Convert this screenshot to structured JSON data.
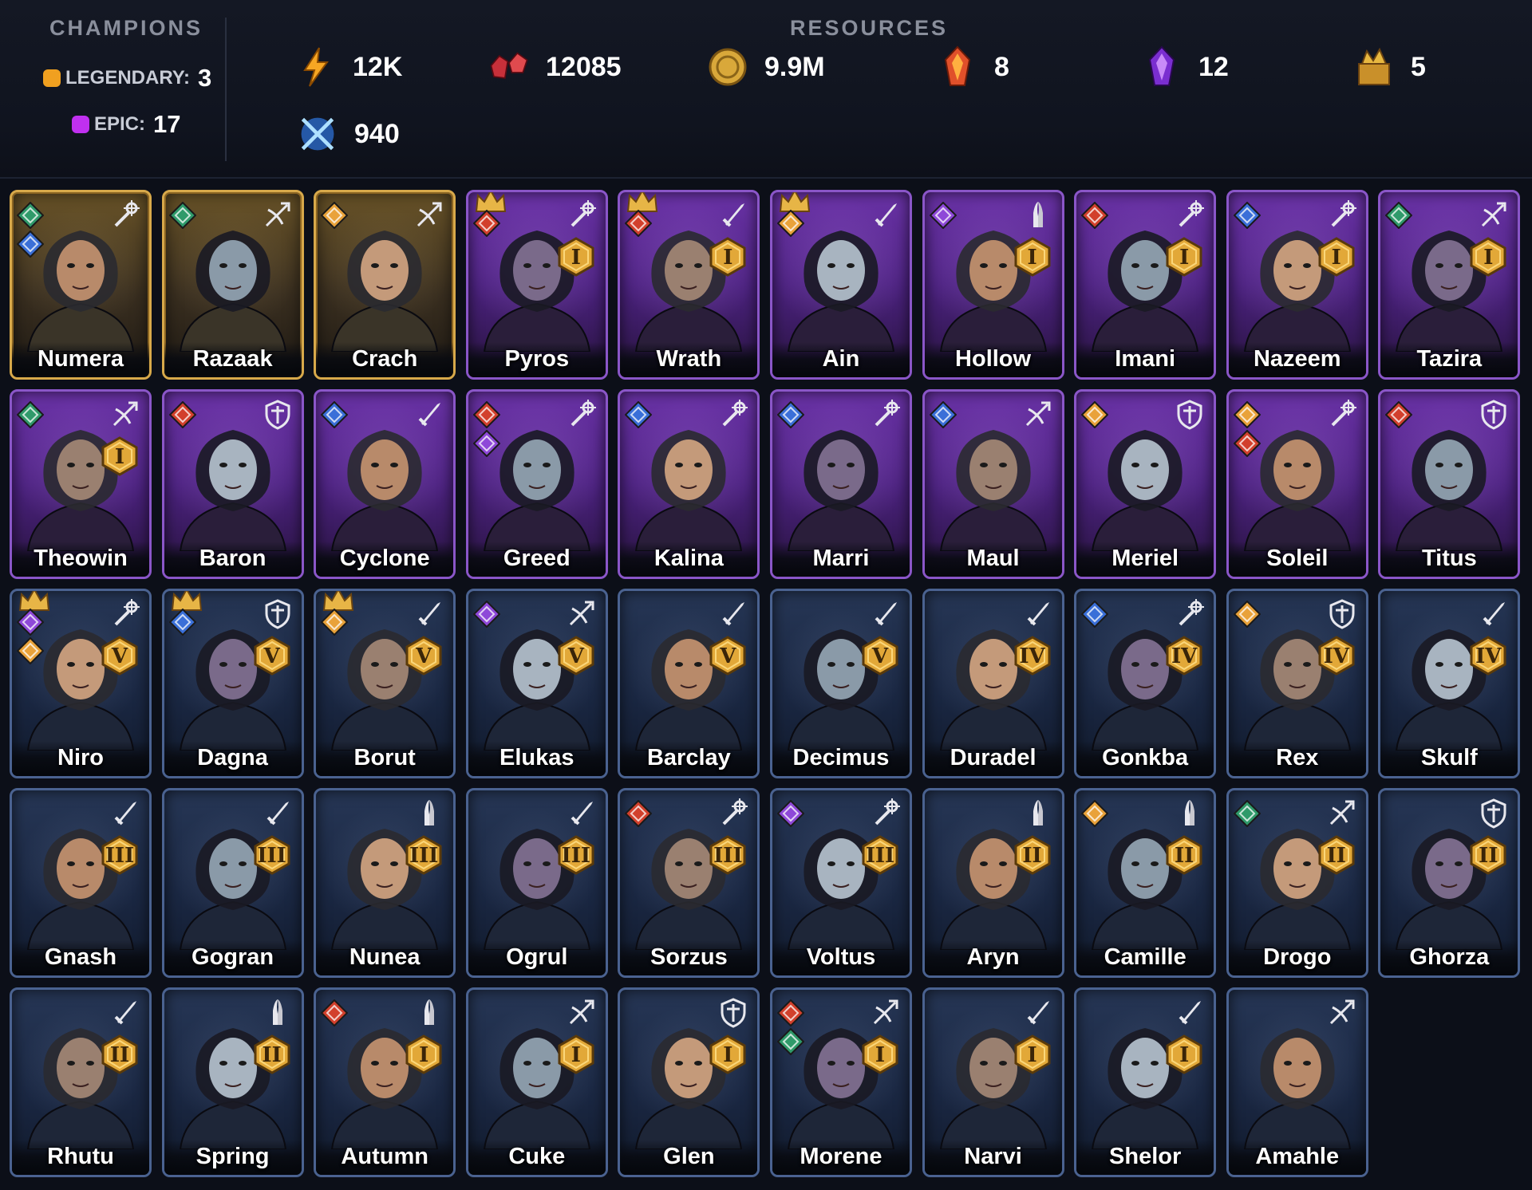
{
  "champions_panel": {
    "title": "CHAMPIONS",
    "legendary_label": "LEGENDARY:",
    "legendary_count": "3",
    "epic_label": "EPIC:",
    "epic_count": "17",
    "legendary_color": "#f0a020",
    "epic_color": "#c030f0"
  },
  "resources_panel": {
    "title": "RESOURCES",
    "items": [
      {
        "name": "energy-icon",
        "value": "12K"
      },
      {
        "name": "rubies-icon",
        "value": "12085"
      },
      {
        "name": "gold-icon",
        "value": "9.9M"
      },
      {
        "name": "legendary-shard-icon",
        "value": "8"
      },
      {
        "name": "epic-shard-icon",
        "value": "12"
      },
      {
        "name": "treasure-icon",
        "value": "5"
      },
      {
        "name": "arena-token-icon",
        "value": "940"
      }
    ]
  },
  "champions": [
    {
      "name": "Numera",
      "rarity": "legendary",
      "class": "magic",
      "affinities": [
        "green",
        "blue"
      ],
      "stars": "",
      "crown": ""
    },
    {
      "name": "Razaak",
      "rarity": "legendary",
      "class": "ranged",
      "affinities": [
        "green"
      ],
      "stars": "",
      "crown": ""
    },
    {
      "name": "Crach",
      "rarity": "legendary",
      "class": "ranged",
      "affinities": [
        "gold"
      ],
      "stars": "",
      "crown": ""
    },
    {
      "name": "Pyros",
      "rarity": "epic",
      "class": "magic",
      "affinities": [
        "red"
      ],
      "stars": "I",
      "crown": "gold"
    },
    {
      "name": "Wrath",
      "rarity": "epic",
      "class": "melee",
      "affinities": [
        "red"
      ],
      "stars": "I",
      "crown": "gold"
    },
    {
      "name": "Ain",
      "rarity": "epic",
      "class": "melee",
      "affinities": [
        "gold"
      ],
      "stars": "",
      "crown": "gold"
    },
    {
      "name": "Hollow",
      "rarity": "epic",
      "class": "support",
      "affinities": [
        "purple"
      ],
      "stars": "I",
      "crown": ""
    },
    {
      "name": "Imani",
      "rarity": "epic",
      "class": "magic",
      "affinities": [
        "red"
      ],
      "stars": "I",
      "crown": ""
    },
    {
      "name": "Nazeem",
      "rarity": "epic",
      "class": "magic",
      "affinities": [
        "blue"
      ],
      "stars": "I",
      "crown": ""
    },
    {
      "name": "Tazira",
      "rarity": "epic",
      "class": "ranged",
      "affinities": [
        "green"
      ],
      "stars": "I",
      "crown": ""
    },
    {
      "name": "Theowin",
      "rarity": "epic",
      "class": "ranged",
      "affinities": [
        "green"
      ],
      "stars": "I",
      "crown": ""
    },
    {
      "name": "Baron",
      "rarity": "epic",
      "class": "tank",
      "affinities": [
        "red"
      ],
      "stars": "",
      "crown": ""
    },
    {
      "name": "Cyclone",
      "rarity": "epic",
      "class": "melee",
      "affinities": [
        "blue"
      ],
      "stars": "",
      "crown": ""
    },
    {
      "name": "Greed",
      "rarity": "epic",
      "class": "magic",
      "affinities": [
        "red",
        "purple"
      ],
      "stars": "",
      "crown": ""
    },
    {
      "name": "Kalina",
      "rarity": "epic",
      "class": "magic",
      "affinities": [
        "blue"
      ],
      "stars": "",
      "crown": ""
    },
    {
      "name": "Marri",
      "rarity": "epic",
      "class": "magic",
      "affinities": [
        "blue"
      ],
      "stars": "",
      "crown": ""
    },
    {
      "name": "Maul",
      "rarity": "epic",
      "class": "ranged",
      "affinities": [
        "blue"
      ],
      "stars": "",
      "crown": ""
    },
    {
      "name": "Meriel",
      "rarity": "epic",
      "class": "tank",
      "affinities": [
        "gold"
      ],
      "stars": "",
      "crown": ""
    },
    {
      "name": "Soleil",
      "rarity": "epic",
      "class": "magic",
      "affinities": [
        "gold",
        "red"
      ],
      "stars": "",
      "crown": ""
    },
    {
      "name": "Titus",
      "rarity": "epic",
      "class": "tank",
      "affinities": [
        "red"
      ],
      "stars": "",
      "crown": ""
    },
    {
      "name": "Niro",
      "rarity": "rare",
      "class": "magic",
      "affinities": [
        "purple",
        "gold"
      ],
      "stars": "V",
      "crown": "gold"
    },
    {
      "name": "Dagna",
      "rarity": "rare",
      "class": "tank",
      "affinities": [
        "blue"
      ],
      "stars": "V",
      "crown": "gold"
    },
    {
      "name": "Borut",
      "rarity": "rare",
      "class": "melee",
      "affinities": [
        "gold"
      ],
      "stars": "V",
      "crown": "gold"
    },
    {
      "name": "Elukas",
      "rarity": "rare",
      "class": "ranged",
      "affinities": [
        "purple"
      ],
      "stars": "V",
      "crown": ""
    },
    {
      "name": "Barclay",
      "rarity": "rare",
      "class": "melee",
      "affinities": [],
      "stars": "V",
      "crown": ""
    },
    {
      "name": "Decimus",
      "rarity": "rare",
      "class": "melee",
      "affinities": [],
      "stars": "V",
      "crown": ""
    },
    {
      "name": "Duradel",
      "rarity": "rare",
      "class": "melee",
      "affinities": [],
      "stars": "IV",
      "crown": ""
    },
    {
      "name": "Gonkba",
      "rarity": "rare",
      "class": "magic",
      "affinities": [
        "blue"
      ],
      "stars": "IV",
      "crown": ""
    },
    {
      "name": "Rex",
      "rarity": "rare",
      "class": "tank",
      "affinities": [
        "gold"
      ],
      "stars": "IV",
      "crown": ""
    },
    {
      "name": "Skulf",
      "rarity": "rare",
      "class": "melee",
      "affinities": [],
      "stars": "IV",
      "crown": ""
    },
    {
      "name": "Gnash",
      "rarity": "rare",
      "class": "melee",
      "affinities": [],
      "stars": "III",
      "crown": ""
    },
    {
      "name": "Gogran",
      "rarity": "rare",
      "class": "melee",
      "affinities": [],
      "stars": "III",
      "crown": ""
    },
    {
      "name": "Nunea",
      "rarity": "rare",
      "class": "support",
      "affinities": [],
      "stars": "III",
      "crown": ""
    },
    {
      "name": "Ogrul",
      "rarity": "rare",
      "class": "melee",
      "affinities": [],
      "stars": "III",
      "crown": ""
    },
    {
      "name": "Sorzus",
      "rarity": "rare",
      "class": "magic",
      "affinities": [
        "red"
      ],
      "stars": "III",
      "crown": ""
    },
    {
      "name": "Voltus",
      "rarity": "rare",
      "class": "magic",
      "affinities": [
        "purple"
      ],
      "stars": "III",
      "crown": ""
    },
    {
      "name": "Aryn",
      "rarity": "rare",
      "class": "support",
      "affinities": [],
      "stars": "II",
      "crown": ""
    },
    {
      "name": "Camille",
      "rarity": "rare",
      "class": "support",
      "affinities": [
        "gold"
      ],
      "stars": "II",
      "crown": ""
    },
    {
      "name": "Drogo",
      "rarity": "rare",
      "class": "ranged",
      "affinities": [
        "green"
      ],
      "stars": "II",
      "crown": ""
    },
    {
      "name": "Ghorza",
      "rarity": "rare",
      "class": "tank",
      "affinities": [],
      "stars": "II",
      "crown": ""
    },
    {
      "name": "Rhutu",
      "rarity": "rare",
      "class": "melee",
      "affinities": [],
      "stars": "II",
      "crown": ""
    },
    {
      "name": "Spring",
      "rarity": "rare",
      "class": "support",
      "affinities": [],
      "stars": "II",
      "crown": ""
    },
    {
      "name": "Autumn",
      "rarity": "rare",
      "class": "support",
      "affinities": [
        "red"
      ],
      "stars": "I",
      "crown": ""
    },
    {
      "name": "Cuke",
      "rarity": "rare",
      "class": "ranged",
      "affinities": [],
      "stars": "I",
      "crown": ""
    },
    {
      "name": "Glen",
      "rarity": "rare",
      "class": "tank",
      "affinities": [],
      "stars": "I",
      "crown": ""
    },
    {
      "name": "Morene",
      "rarity": "rare",
      "class": "ranged",
      "affinities": [
        "red",
        "green"
      ],
      "stars": "I",
      "crown": ""
    },
    {
      "name": "Narvi",
      "rarity": "rare",
      "class": "melee",
      "affinities": [],
      "stars": "I",
      "crown": ""
    },
    {
      "name": "Shelor",
      "rarity": "rare",
      "class": "melee",
      "affinities": [],
      "stars": "I",
      "crown": ""
    },
    {
      "name": "Amahle",
      "rarity": "rare",
      "class": "ranged",
      "affinities": [],
      "stars": "",
      "crown": ""
    }
  ],
  "affinity_colors": {
    "green": "#2f9a6a",
    "blue": "#3a6fd8",
    "gold": "#e9a23a",
    "red": "#d2402c",
    "purple": "#8e48d8"
  },
  "class_icons": {
    "magic": "staff-icon",
    "ranged": "bow-icon",
    "melee": "sword-icon",
    "support": "praying-hands-icon",
    "tank": "shield-icon"
  }
}
